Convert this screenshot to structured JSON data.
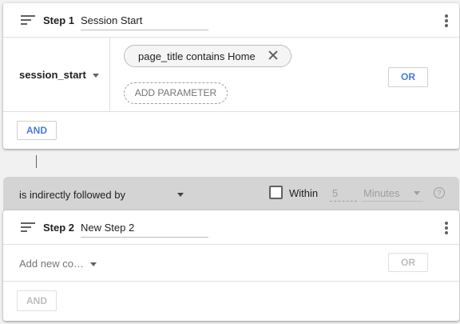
{
  "step1": {
    "label": "Step 1",
    "name": "Session Start",
    "event": "session_start",
    "chip": "page_title contains Home",
    "add_parameter": "ADD PARAMETER",
    "or_label": "OR",
    "and_label": "AND"
  },
  "sequence": {
    "relation": "is indirectly followed by",
    "within_label": "Within",
    "within_checked": false,
    "within_value": "5",
    "within_unit": "Minutes",
    "help": "?"
  },
  "step2": {
    "label": "Step 2",
    "name": "New Step 2",
    "add_condition": "Add new co…",
    "or_label": "OR",
    "and_label": "AND"
  },
  "icons": {
    "sort": "sort-icon",
    "more": "more-vert-icon",
    "dropdown": "chevron-down-icon",
    "close": "close-icon",
    "help": "help-icon",
    "checkbox": "checkbox-icon"
  },
  "colors": {
    "accent": "#4a7bd6",
    "disabled": "#bdbdbd",
    "sequence_bar": "#d4d4d4",
    "page_bg": "#f1f1f1"
  }
}
